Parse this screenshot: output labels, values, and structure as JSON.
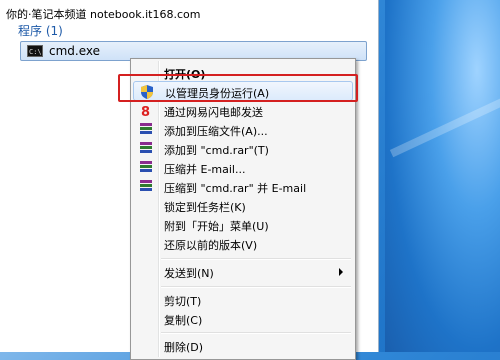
{
  "watermark": "你的·笔记本频道 notebook.it168.com",
  "results_section": {
    "title": "程序 (1)"
  },
  "result_item": {
    "label": "cmd.exe",
    "icon": "cmd-icon",
    "icon_text": "C:\\"
  },
  "context_menu": {
    "items": [
      {
        "label": "打开(O)",
        "bold": true,
        "icon": ""
      },
      {
        "label": "以管理员身份运行(A)",
        "icon": "uac-shield-icon",
        "highlighted": true
      },
      {
        "label": "通过网易闪电邮发送",
        "icon": "mail-icon"
      },
      {
        "label": "添加到压缩文件(A)...",
        "icon": "winrar-icon"
      },
      {
        "label": "添加到 \"cmd.rar\"(T)",
        "icon": "winrar-icon"
      },
      {
        "label": "压缩并 E-mail...",
        "icon": "winrar-icon"
      },
      {
        "label": "压缩到 \"cmd.rar\" 并 E-mail",
        "icon": "winrar-icon"
      },
      {
        "label": "锁定到任务栏(K)",
        "icon": ""
      },
      {
        "label": "附到「开始」菜单(U)",
        "icon": ""
      },
      {
        "label": "还原以前的版本(V)",
        "icon": ""
      },
      {
        "label": "发送到(N)",
        "icon": "",
        "submenu": true
      },
      {
        "label": "剪切(T)",
        "icon": ""
      },
      {
        "label": "复制(C)",
        "icon": ""
      },
      {
        "label": "删除(D)",
        "icon": ""
      }
    ]
  },
  "colors": {
    "highlight_box": "#d42020",
    "section_title": "#1e5aa8"
  }
}
